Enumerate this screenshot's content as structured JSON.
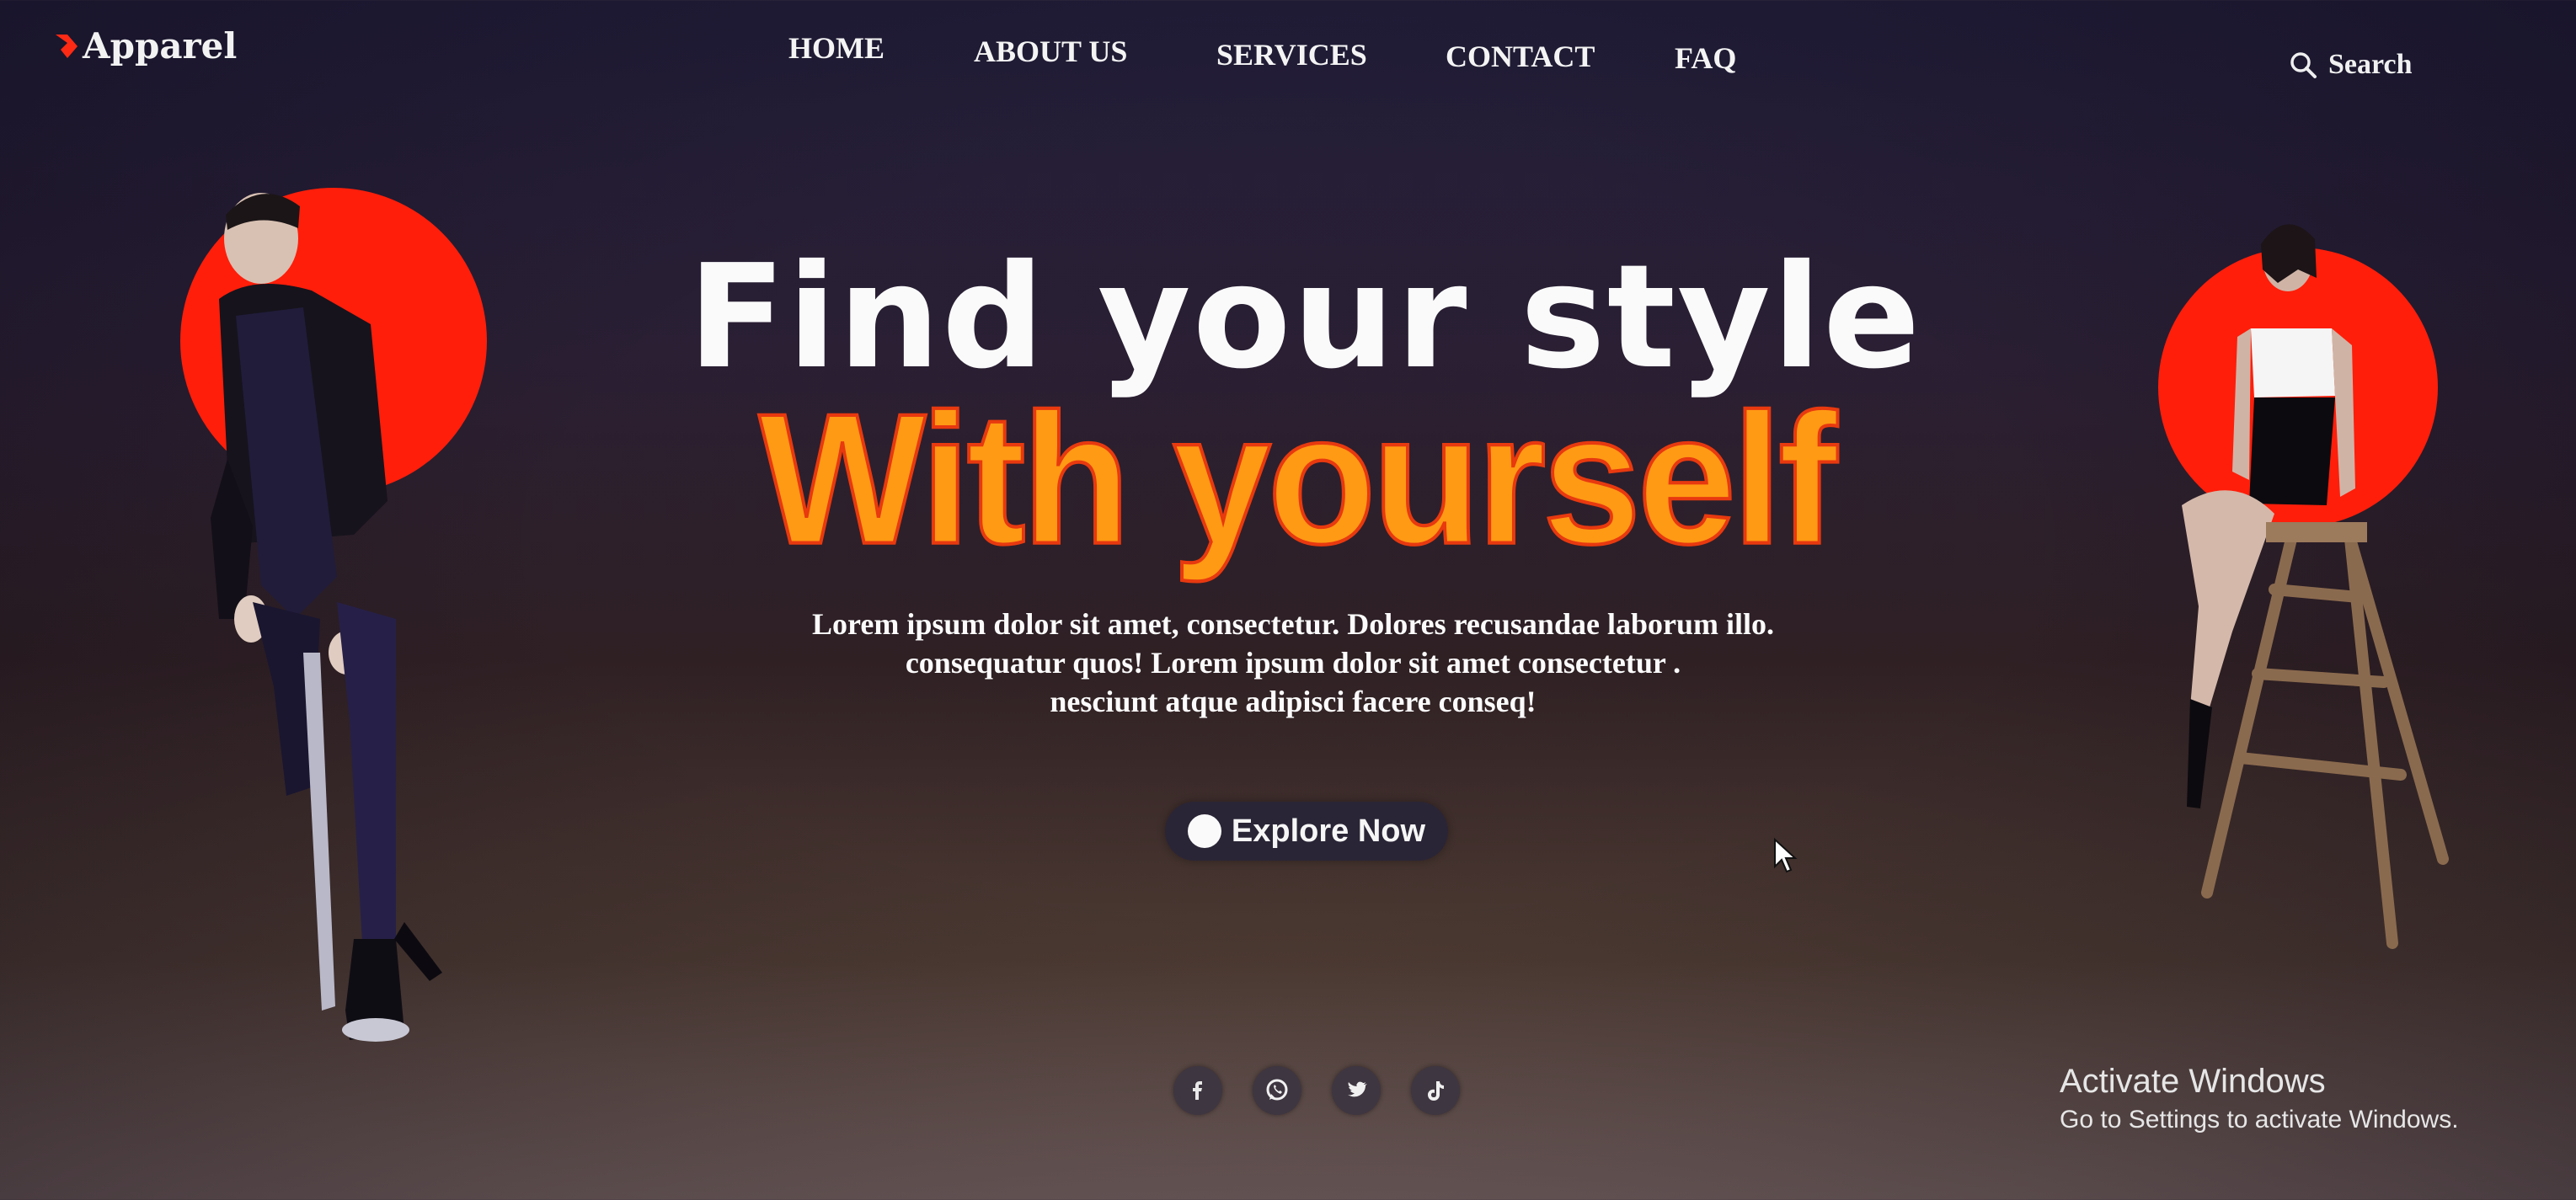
{
  "brand": {
    "name": "Apparel",
    "accent": "#ff2a14"
  },
  "nav": {
    "items": [
      {
        "label": "HOME"
      },
      {
        "label": "ABOUT US"
      },
      {
        "label": "SERVICES"
      },
      {
        "label": "CONTACT"
      },
      {
        "label": "FAQ"
      }
    ]
  },
  "search": {
    "label": "Search",
    "icon": "search-icon"
  },
  "hero": {
    "headline_1": "Find your style",
    "headline_2": "With yourself",
    "headline_2_color": "#ff9a14",
    "lead_lines": [
      "Lorem ipsum dolor sit amet, consectetur. Dolores recusandae laborum illo.",
      "consequatur quos! Lorem ipsum dolor sit amet consectetur .",
      "nesciunt atque adipisci facere conseq!"
    ],
    "cta_label": "Explore Now"
  },
  "socials": [
    {
      "icon": "facebook-icon"
    },
    {
      "icon": "whatsapp-icon"
    },
    {
      "icon": "twitter-icon"
    },
    {
      "icon": "tiktok-icon"
    }
  ],
  "os_notice": {
    "title": "Activate Windows",
    "subtitle": "Go to Settings to activate Windows."
  }
}
